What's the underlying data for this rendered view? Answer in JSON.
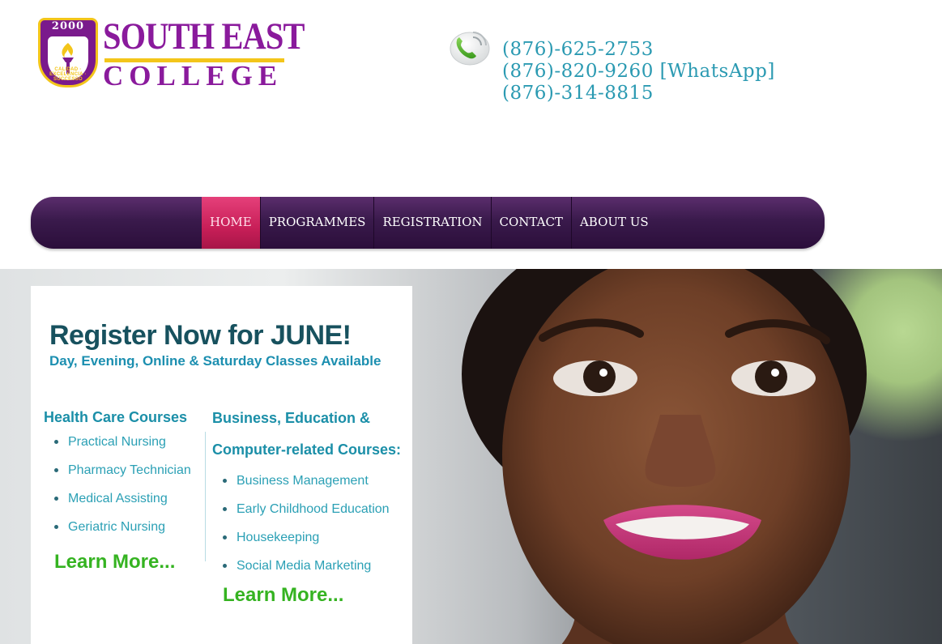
{
  "logo": {
    "year": "2000",
    "motto": "CALIDAD · EXCELENCIA · SUCCESSO",
    "name_line1": "SOUTH EAST",
    "name_line2": "COLLEGE"
  },
  "contact": {
    "phones": [
      "(876)-625-2753",
      "(876)-820-9260 [WhatsApp]",
      "(876)-314-8815"
    ]
  },
  "nav": {
    "items": [
      {
        "label": "HOME",
        "active": true
      },
      {
        "label": "PROGRAMMES",
        "active": false
      },
      {
        "label": "REGISTRATION",
        "active": false
      },
      {
        "label": "CONTACT",
        "active": false
      },
      {
        "label": "ABOUT US",
        "active": false
      }
    ]
  },
  "promo": {
    "headline": "Register Now for JUNE!",
    "subhead": "Day, Evening, Online & Saturday Classes Available",
    "health": {
      "title": "Health Care Courses",
      "courses": [
        "Practical Nursing",
        "Pharmacy Technician",
        "Medical Assisting",
        "Geriatric Nursing"
      ],
      "learn_more": "Learn More..."
    },
    "business": {
      "title_line1": "Business, Education &",
      "title_line2": "Computer-related Courses:",
      "courses": [
        "Business Management",
        "Early Childhood Education",
        "Housekeeping",
        "Social Media Marketing"
      ],
      "learn_more": "Learn More..."
    }
  },
  "colors": {
    "brand_purple": "#8a1a9c",
    "brand_gold": "#f3c51a",
    "nav_dark": "#2b0e3a",
    "nav_active": "#c81f58",
    "phone_teal": "#2b9ab2",
    "headline": "#17515e",
    "course_teal": "#2ba0b5",
    "learn_green": "#35b321"
  }
}
